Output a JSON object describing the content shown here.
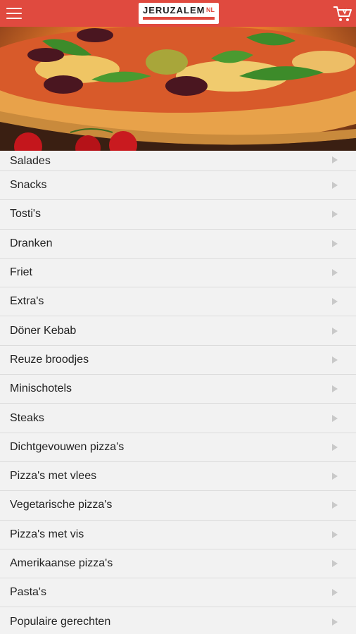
{
  "header": {
    "logo_text": "JERUZALEM",
    "logo_mark": "NL",
    "menu_icon": "hamburger-menu-icon",
    "cart_icon": "shopping-cart-icon",
    "brand_color": "#e04a3f"
  },
  "hero": {
    "image": "pizza-banner"
  },
  "categories": [
    {
      "label": "Salades"
    },
    {
      "label": "Snacks"
    },
    {
      "label": "Tosti's"
    },
    {
      "label": "Dranken"
    },
    {
      "label": "Friet"
    },
    {
      "label": "Extra's"
    },
    {
      "label": "Döner Kebab"
    },
    {
      "label": "Reuze broodjes"
    },
    {
      "label": "Minischotels"
    },
    {
      "label": "Steaks"
    },
    {
      "label": "Dichtgevouwen pizza's"
    },
    {
      "label": "Pizza's met vlees"
    },
    {
      "label": "Vegetarische pizza's"
    },
    {
      "label": "Pizza's met vis"
    },
    {
      "label": "Amerikaanse pizza's"
    },
    {
      "label": "Pasta's"
    },
    {
      "label": "Populaire gerechten"
    }
  ]
}
